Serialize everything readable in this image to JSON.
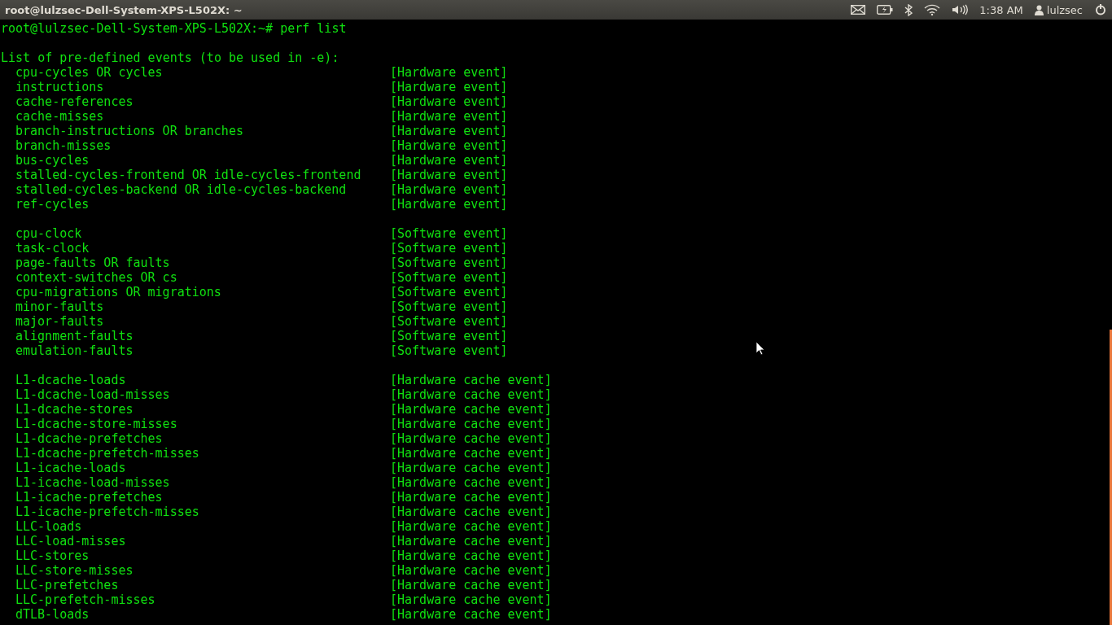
{
  "top_bar": {
    "title": "root@lulzsec-Dell-System-XPS-L502X: ~",
    "clock": "1:38 AM",
    "user": "lulzsec"
  },
  "terminal": {
    "prompt": "root@lulzsec-Dell-System-XPS-L502X:~# perf list",
    "heading": "List of pre-defined events (to be used in -e):",
    "groups": [
      {
        "events": [
          {
            "name": "cpu-cycles OR cycles",
            "type": "[Hardware event]"
          },
          {
            "name": "instructions",
            "type": "[Hardware event]"
          },
          {
            "name": "cache-references",
            "type": "[Hardware event]"
          },
          {
            "name": "cache-misses",
            "type": "[Hardware event]"
          },
          {
            "name": "branch-instructions OR branches",
            "type": "[Hardware event]"
          },
          {
            "name": "branch-misses",
            "type": "[Hardware event]"
          },
          {
            "name": "bus-cycles",
            "type": "[Hardware event]"
          },
          {
            "name": "stalled-cycles-frontend OR idle-cycles-frontend",
            "type": "[Hardware event]"
          },
          {
            "name": "stalled-cycles-backend OR idle-cycles-backend",
            "type": "[Hardware event]"
          },
          {
            "name": "ref-cycles",
            "type": "[Hardware event]"
          }
        ]
      },
      {
        "events": [
          {
            "name": "cpu-clock",
            "type": "[Software event]"
          },
          {
            "name": "task-clock",
            "type": "[Software event]"
          },
          {
            "name": "page-faults OR faults",
            "type": "[Software event]"
          },
          {
            "name": "context-switches OR cs",
            "type": "[Software event]"
          },
          {
            "name": "cpu-migrations OR migrations",
            "type": "[Software event]"
          },
          {
            "name": "minor-faults",
            "type": "[Software event]"
          },
          {
            "name": "major-faults",
            "type": "[Software event]"
          },
          {
            "name": "alignment-faults",
            "type": "[Software event]"
          },
          {
            "name": "emulation-faults",
            "type": "[Software event]"
          }
        ]
      },
      {
        "events": [
          {
            "name": "L1-dcache-loads",
            "type": "[Hardware cache event]"
          },
          {
            "name": "L1-dcache-load-misses",
            "type": "[Hardware cache event]"
          },
          {
            "name": "L1-dcache-stores",
            "type": "[Hardware cache event]"
          },
          {
            "name": "L1-dcache-store-misses",
            "type": "[Hardware cache event]"
          },
          {
            "name": "L1-dcache-prefetches",
            "type": "[Hardware cache event]"
          },
          {
            "name": "L1-dcache-prefetch-misses",
            "type": "[Hardware cache event]"
          },
          {
            "name": "L1-icache-loads",
            "type": "[Hardware cache event]"
          },
          {
            "name": "L1-icache-load-misses",
            "type": "[Hardware cache event]"
          },
          {
            "name": "L1-icache-prefetches",
            "type": "[Hardware cache event]"
          },
          {
            "name": "L1-icache-prefetch-misses",
            "type": "[Hardware cache event]"
          },
          {
            "name": "LLC-loads",
            "type": "[Hardware cache event]"
          },
          {
            "name": "LLC-load-misses",
            "type": "[Hardware cache event]"
          },
          {
            "name": "LLC-stores",
            "type": "[Hardware cache event]"
          },
          {
            "name": "LLC-store-misses",
            "type": "[Hardware cache event]"
          },
          {
            "name": "LLC-prefetches",
            "type": "[Hardware cache event]"
          },
          {
            "name": "LLC-prefetch-misses",
            "type": "[Hardware cache event]"
          },
          {
            "name": "dTLB-loads",
            "type": "[Hardware cache event]"
          }
        ]
      }
    ]
  }
}
